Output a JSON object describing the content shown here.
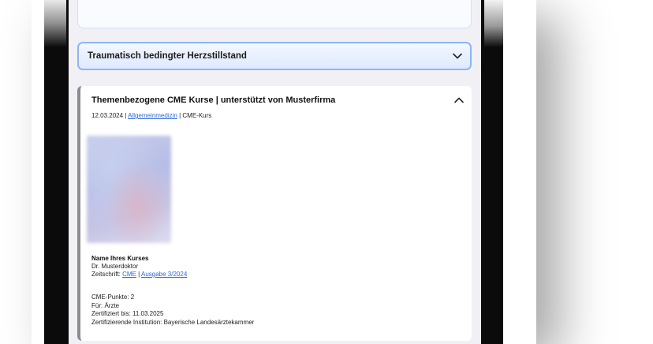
{
  "accordion_collapsed": {
    "title": "Traumatisch bedingter Herzstillstand"
  },
  "card": {
    "title": "Themenbezogene CME Kurse | unterstützt von Musterfirma",
    "date": "12.03.2024",
    "sep1": " | ",
    "category_link": "Allgemeinmedizin",
    "sep2": " | ",
    "type": "CME-Kurs",
    "course": {
      "name": "Name Ihres Kurses",
      "author": "Dr. Musterdoktor",
      "journal_label": "Zeitschrift: ",
      "journal_link": "CME",
      "journal_sep": " | ",
      "issue_link": "Ausgabe 3/2024"
    },
    "cme": {
      "points": "CME-Punkte: 2",
      "for": "Für: Ärzte",
      "certified_until": "Zertifiziert bis: 11.03.2025",
      "institution": "Zertifizierende Institution: Bayerische Landesärztekammer"
    }
  },
  "icons": {
    "collapsed_chevron": "chevron-down-icon",
    "expanded_chevron": "chevron-up-icon"
  },
  "colors": {
    "accent": "#8cb5f3",
    "link": "#2e68d6",
    "card_border": "#8c8c8c"
  }
}
